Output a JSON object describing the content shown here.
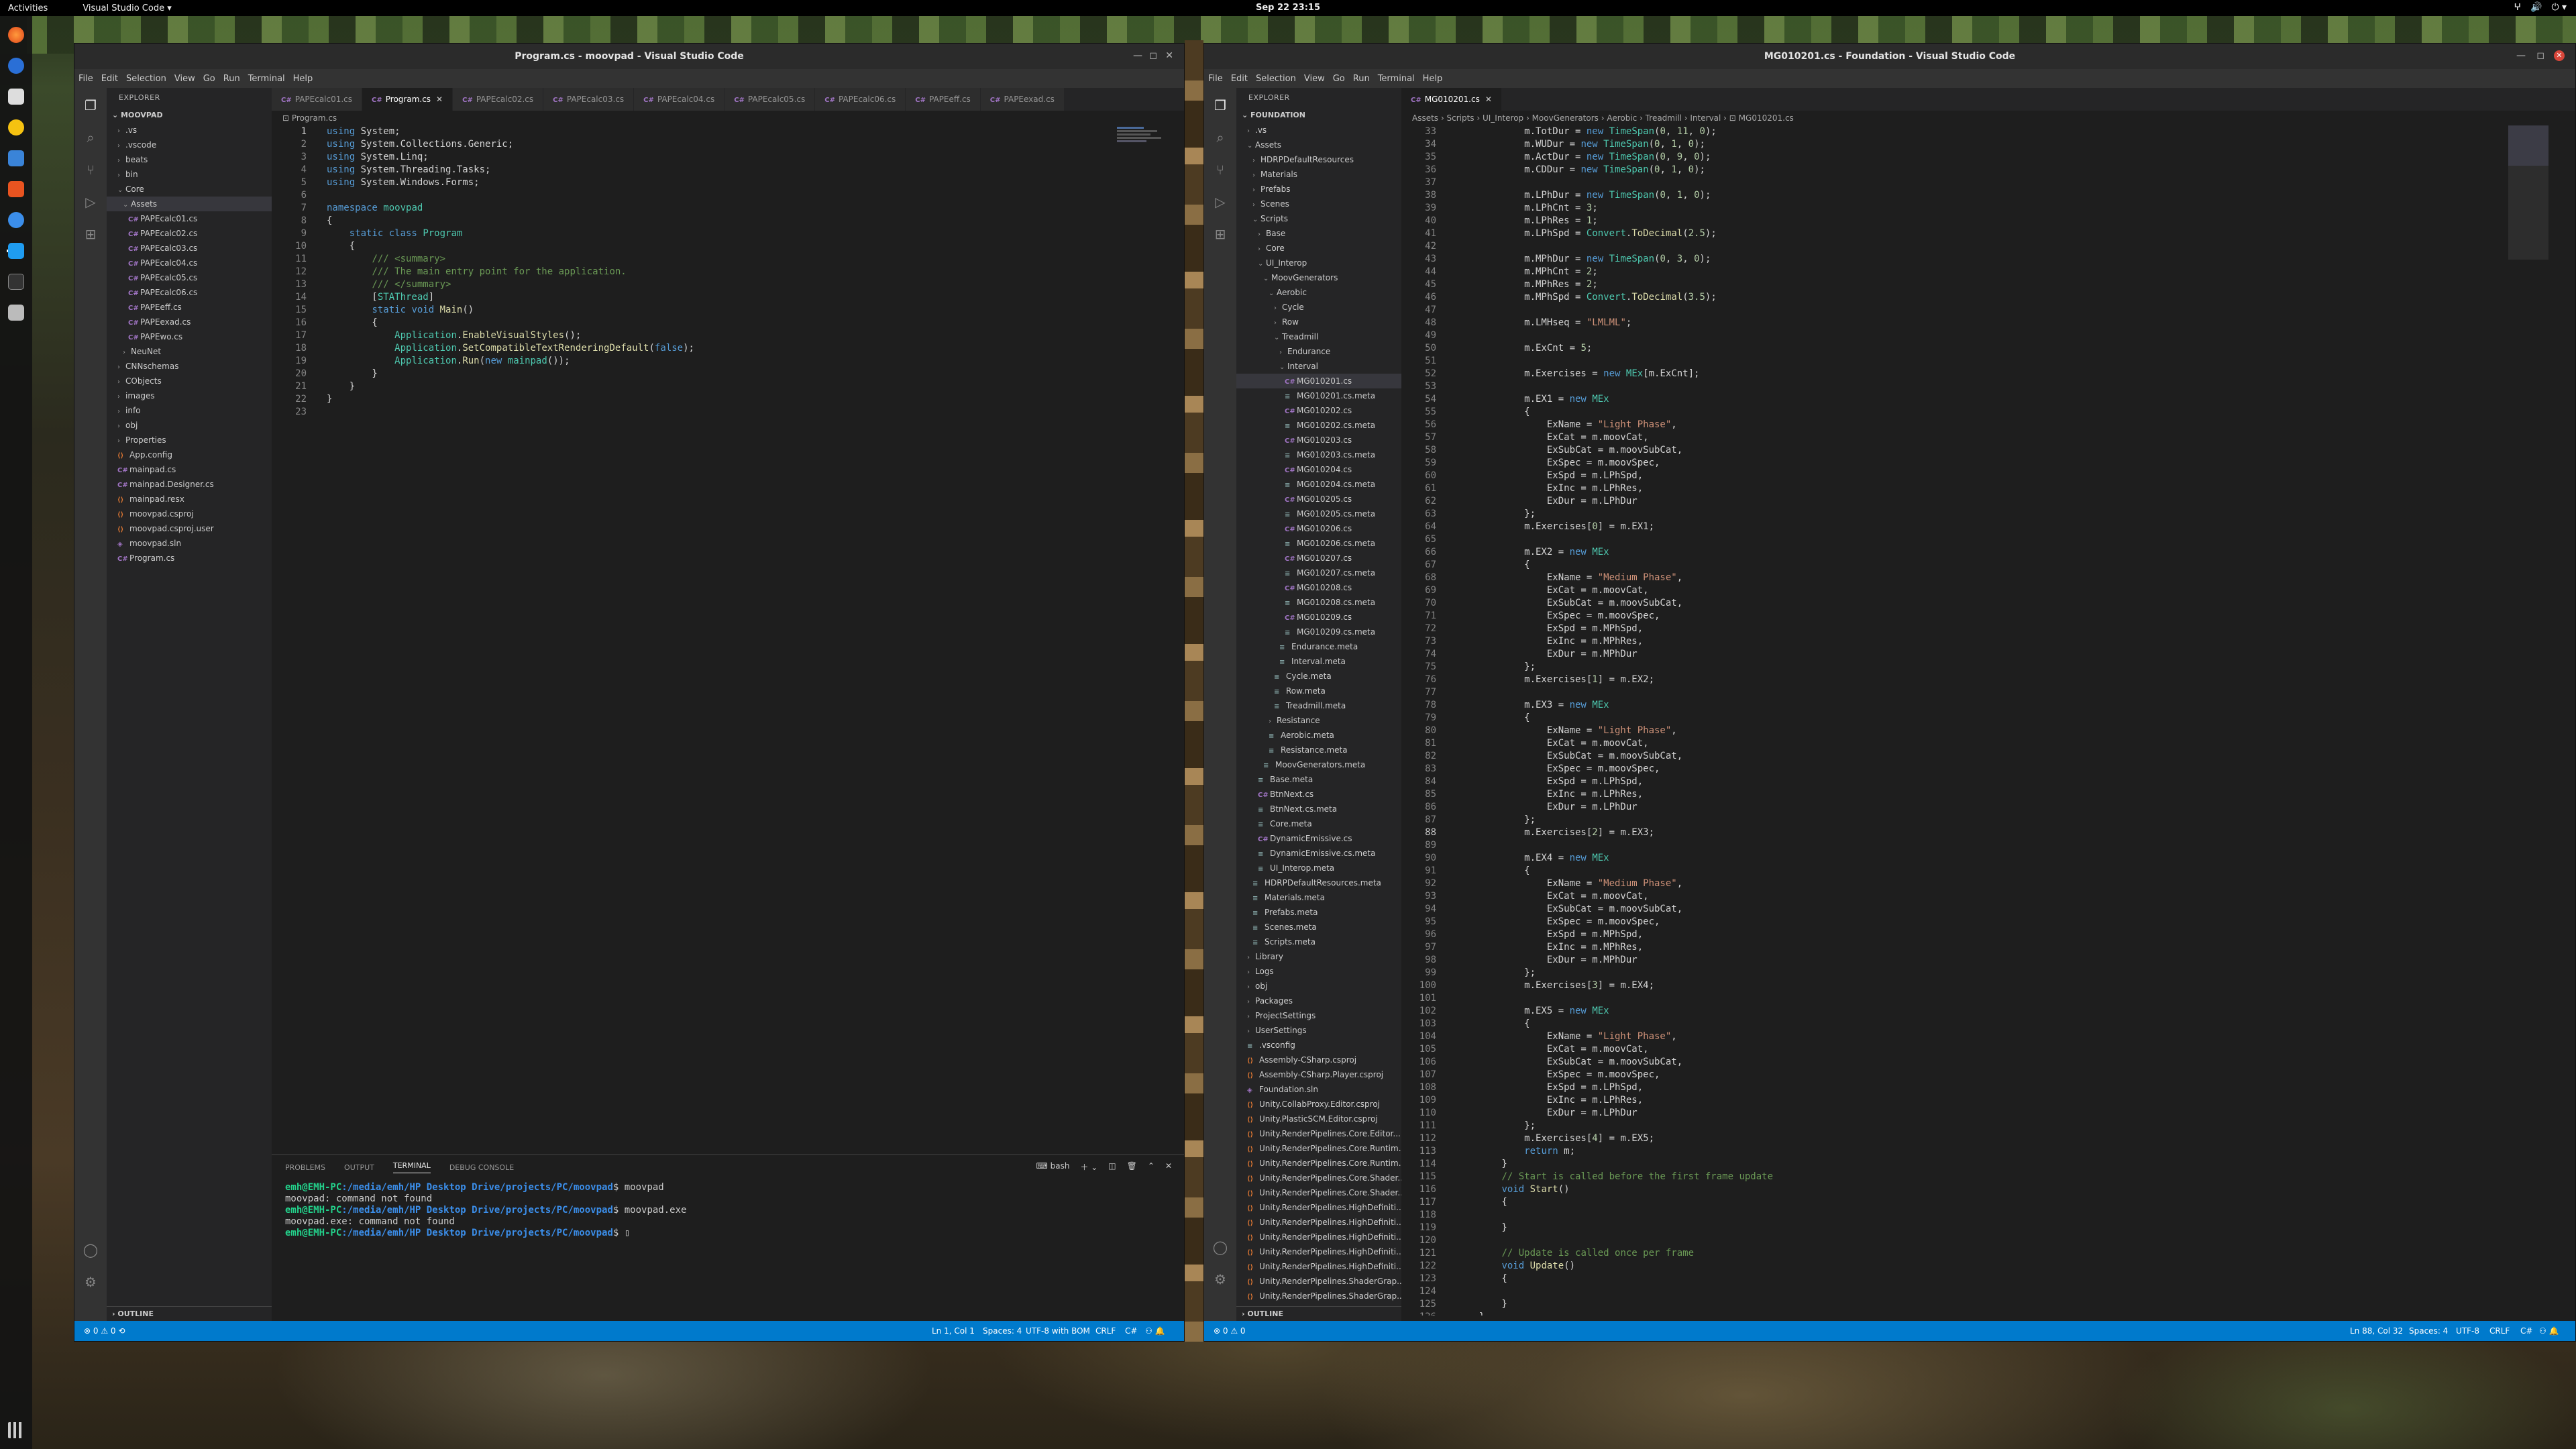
{
  "topbar": {
    "activities": "Activities",
    "app_menu": "Visual Studio Code ▾",
    "clock": "Sep 22  23:15",
    "tray": [
      "ⵖ",
      "🔊",
      "⏻ ▾"
    ]
  },
  "colors": {
    "vscode_blue": "#007acc",
    "editor_bg": "#1e1e1e",
    "sidebar_bg": "#252526"
  },
  "left_window": {
    "title": "Program.cs - moovpad - Visual Studio Code",
    "menu": [
      "File",
      "Edit",
      "Selection",
      "View",
      "Go",
      "Run",
      "Terminal",
      "Help"
    ],
    "explorer_title": "EXPLORER",
    "root": "MOOVPAD",
    "tree": [
      {
        "label": ".vs",
        "depth": 1,
        "kind": "folder"
      },
      {
        "label": ".vscode",
        "depth": 1,
        "kind": "folder"
      },
      {
        "label": "beats",
        "depth": 1,
        "kind": "folder"
      },
      {
        "label": "bin",
        "depth": 1,
        "kind": "folder"
      },
      {
        "label": "Core",
        "depth": 1,
        "kind": "folder-open"
      },
      {
        "label": "Assets",
        "depth": 2,
        "kind": "folder-open",
        "selected": true
      },
      {
        "label": "PAPEcalc01.cs",
        "depth": 3,
        "kind": "cs"
      },
      {
        "label": "PAPEcalc02.cs",
        "depth": 3,
        "kind": "cs"
      },
      {
        "label": "PAPEcalc03.cs",
        "depth": 3,
        "kind": "cs"
      },
      {
        "label": "PAPEcalc04.cs",
        "depth": 3,
        "kind": "cs"
      },
      {
        "label": "PAPEcalc05.cs",
        "depth": 3,
        "kind": "cs"
      },
      {
        "label": "PAPEcalc06.cs",
        "depth": 3,
        "kind": "cs"
      },
      {
        "label": "PAPEeff.cs",
        "depth": 3,
        "kind": "cs"
      },
      {
        "label": "PAPEexad.cs",
        "depth": 3,
        "kind": "cs"
      },
      {
        "label": "PAPEwo.cs",
        "depth": 3,
        "kind": "cs"
      },
      {
        "label": "NeuNet",
        "depth": 2,
        "kind": "folder"
      },
      {
        "label": "CNNschemas",
        "depth": 1,
        "kind": "folder"
      },
      {
        "label": "CObjects",
        "depth": 1,
        "kind": "folder"
      },
      {
        "label": "images",
        "depth": 1,
        "kind": "folder"
      },
      {
        "label": "info",
        "depth": 1,
        "kind": "folder"
      },
      {
        "label": "obj",
        "depth": 1,
        "kind": "folder"
      },
      {
        "label": "Properties",
        "depth": 1,
        "kind": "folder"
      },
      {
        "label": "App.config",
        "depth": 1,
        "kind": "xml"
      },
      {
        "label": "mainpad.cs",
        "depth": 1,
        "kind": "cs"
      },
      {
        "label": "mainpad.Designer.cs",
        "depth": 1,
        "kind": "cs"
      },
      {
        "label": "mainpad.resx",
        "depth": 1,
        "kind": "resx"
      },
      {
        "label": "moovpad.csproj",
        "depth": 1,
        "kind": "xml"
      },
      {
        "label": "moovpad.csproj.user",
        "depth": 1,
        "kind": "xml"
      },
      {
        "label": "moovpad.sln",
        "depth": 1,
        "kind": "sln"
      },
      {
        "label": "Program.cs",
        "depth": 1,
        "kind": "cs"
      }
    ],
    "outline": "OUTLINE",
    "tabs": [
      "PAPEcalc01.cs",
      "Program.cs",
      "PAPEcalc02.cs",
      "PAPEcalc03.cs",
      "PAPEcalc04.cs",
      "PAPEcalc05.cs",
      "PAPEcalc06.cs",
      "PAPEeff.cs",
      "PAPEexad.cs"
    ],
    "active_tab": 1,
    "breadcrumb": "Program.cs",
    "code": [
      "<span class=\"kw\">using</span> System;",
      "<span class=\"kw\">using</span> System.Collections.Generic;",
      "<span class=\"kw\">using</span> System.Linq;",
      "<span class=\"kw\">using</span> System.Threading.Tasks;",
      "<span class=\"kw\">using</span> System.Windows.Forms;",
      "",
      "<span class=\"kw\">namespace</span> <span class=\"ns\">moovpad</span>",
      "{",
      "    <span class=\"kw\">static class</span> <span class=\"ty\">Program</span>",
      "    {",
      "        <span class=\"cm\">/// &lt;summary&gt;</span>",
      "        <span class=\"cm\">/// The main entry point for the application.</span>",
      "        <span class=\"cm\">/// &lt;/summary&gt;</span>",
      "        [<span class=\"ty\">STAThread</span>]",
      "        <span class=\"kw\">static void</span> <span class=\"fn\">Main</span>()",
      "        {",
      "            <span class=\"ty\">Application</span>.<span class=\"fn\">EnableVisualStyles</span>();",
      "            <span class=\"ty\">Application</span>.<span class=\"fn\">SetCompatibleTextRenderingDefault</span>(<span class=\"kw\">false</span>);",
      "            <span class=\"ty\">Application</span>.<span class=\"fn\">Run</span>(<span class=\"kw\">new</span> <span class=\"ty\">mainpad</span>());",
      "        }",
      "    }",
      "}",
      ""
    ],
    "panel_tabs": [
      "PROBLEMS",
      "OUTPUT",
      "TERMINAL",
      "DEBUG CONSOLE"
    ],
    "panel_active": 2,
    "panel_shell": "bash",
    "terminal": [
      {
        "user": "emh@EMH-PC",
        "path": ":/media/emh/HP Desktop Drive/projects/PC/moovpad",
        "cmd": "$ moovpad"
      },
      {
        "text": "moovpad: command not found"
      },
      {
        "user": "emh@EMH-PC",
        "path": ":/media/emh/HP Desktop Drive/projects/PC/moovpad",
        "cmd": "$ moovpad.exe"
      },
      {
        "text": "moovpad.exe: command not found"
      },
      {
        "user": "emh@EMH-PC",
        "path": ":/media/emh/HP Desktop Drive/projects/PC/moovpad",
        "cmd": "$ ▯"
      }
    ],
    "status": {
      "left": "⊗ 0 ⚠ 0  ⟲",
      "pos": "Ln 1, Col 1",
      "spaces": "Spaces: 4",
      "enc": "UTF-8 with BOM",
      "eol": "CRLF",
      "lang": "C#",
      "icons": "⚇ 🔔"
    }
  },
  "right_window": {
    "title": "MG010201.cs - Foundation - Visual Studio Code",
    "menu": [
      "File",
      "Edit",
      "Selection",
      "View",
      "Go",
      "Run",
      "Terminal",
      "Help"
    ],
    "explorer_title": "EXPLORER",
    "root": "FOUNDATION",
    "tree": [
      {
        "label": ".vs",
        "depth": 1,
        "kind": "folder"
      },
      {
        "label": "Assets",
        "depth": 1,
        "kind": "folder-open"
      },
      {
        "label": "HDRPDefaultResources",
        "depth": 2,
        "kind": "folder"
      },
      {
        "label": "Materials",
        "depth": 2,
        "kind": "folder"
      },
      {
        "label": "Prefabs",
        "depth": 2,
        "kind": "folder"
      },
      {
        "label": "Scenes",
        "depth": 2,
        "kind": "folder"
      },
      {
        "label": "Scripts",
        "depth": 2,
        "kind": "folder-open"
      },
      {
        "label": "Base",
        "depth": 3,
        "kind": "folder"
      },
      {
        "label": "Core",
        "depth": 3,
        "kind": "folder"
      },
      {
        "label": "UI_Interop",
        "depth": 3,
        "kind": "folder-open"
      },
      {
        "label": "MoovGenerators",
        "depth": 4,
        "kind": "folder-open"
      },
      {
        "label": "Aerobic",
        "depth": 5,
        "kind": "folder-open"
      },
      {
        "label": "Cycle",
        "depth": 6,
        "kind": "folder"
      },
      {
        "label": "Row",
        "depth": 6,
        "kind": "folder"
      },
      {
        "label": "Treadmill",
        "depth": 6,
        "kind": "folder-open"
      },
      {
        "label": "Endurance",
        "depth": 7,
        "kind": "folder"
      },
      {
        "label": "Interval",
        "depth": 7,
        "kind": "folder-open"
      },
      {
        "label": "MG010201.cs",
        "depth": 8,
        "kind": "cs",
        "selected": true
      },
      {
        "label": "MG010201.cs.meta",
        "depth": 8,
        "kind": "meta"
      },
      {
        "label": "MG010202.cs",
        "depth": 8,
        "kind": "cs"
      },
      {
        "label": "MG010202.cs.meta",
        "depth": 8,
        "kind": "meta"
      },
      {
        "label": "MG010203.cs",
        "depth": 8,
        "kind": "cs"
      },
      {
        "label": "MG010203.cs.meta",
        "depth": 8,
        "kind": "meta"
      },
      {
        "label": "MG010204.cs",
        "depth": 8,
        "kind": "cs"
      },
      {
        "label": "MG010204.cs.meta",
        "depth": 8,
        "kind": "meta"
      },
      {
        "label": "MG010205.cs",
        "depth": 8,
        "kind": "cs"
      },
      {
        "label": "MG010205.cs.meta",
        "depth": 8,
        "kind": "meta"
      },
      {
        "label": "MG010206.cs",
        "depth": 8,
        "kind": "cs"
      },
      {
        "label": "MG010206.cs.meta",
        "depth": 8,
        "kind": "meta"
      },
      {
        "label": "MG010207.cs",
        "depth": 8,
        "kind": "cs"
      },
      {
        "label": "MG010207.cs.meta",
        "depth": 8,
        "kind": "meta"
      },
      {
        "label": "MG010208.cs",
        "depth": 8,
        "kind": "cs"
      },
      {
        "label": "MG010208.cs.meta",
        "depth": 8,
        "kind": "meta"
      },
      {
        "label": "MG010209.cs",
        "depth": 8,
        "kind": "cs"
      },
      {
        "label": "MG010209.cs.meta",
        "depth": 8,
        "kind": "meta"
      },
      {
        "label": "Endurance.meta",
        "depth": 7,
        "kind": "meta"
      },
      {
        "label": "Interval.meta",
        "depth": 7,
        "kind": "meta"
      },
      {
        "label": "Cycle.meta",
        "depth": 6,
        "kind": "meta"
      },
      {
        "label": "Row.meta",
        "depth": 6,
        "kind": "meta"
      },
      {
        "label": "Treadmill.meta",
        "depth": 6,
        "kind": "meta"
      },
      {
        "label": "Resistance",
        "depth": 5,
        "kind": "folder"
      },
      {
        "label": "Aerobic.meta",
        "depth": 5,
        "kind": "meta"
      },
      {
        "label": "Resistance.meta",
        "depth": 5,
        "kind": "meta"
      },
      {
        "label": "MoovGenerators.meta",
        "depth": 4,
        "kind": "meta"
      },
      {
        "label": "Base.meta",
        "depth": 3,
        "kind": "meta"
      },
      {
        "label": "BtnNext.cs",
        "depth": 3,
        "kind": "cs"
      },
      {
        "label": "BtnNext.cs.meta",
        "depth": 3,
        "kind": "meta"
      },
      {
        "label": "Core.meta",
        "depth": 3,
        "kind": "meta"
      },
      {
        "label": "DynamicEmissive.cs",
        "depth": 3,
        "kind": "cs"
      },
      {
        "label": "DynamicEmissive.cs.meta",
        "depth": 3,
        "kind": "meta"
      },
      {
        "label": "UI_Interop.meta",
        "depth": 3,
        "kind": "meta"
      },
      {
        "label": "HDRPDefaultResources.meta",
        "depth": 2,
        "kind": "meta"
      },
      {
        "label": "Materials.meta",
        "depth": 2,
        "kind": "meta"
      },
      {
        "label": "Prefabs.meta",
        "depth": 2,
        "kind": "meta"
      },
      {
        "label": "Scenes.meta",
        "depth": 2,
        "kind": "meta"
      },
      {
        "label": "Scripts.meta",
        "depth": 2,
        "kind": "meta"
      },
      {
        "label": "Library",
        "depth": 1,
        "kind": "folder"
      },
      {
        "label": "Logs",
        "depth": 1,
        "kind": "folder"
      },
      {
        "label": "obj",
        "depth": 1,
        "kind": "folder"
      },
      {
        "label": "Packages",
        "depth": 1,
        "kind": "folder"
      },
      {
        "label": "ProjectSettings",
        "depth": 1,
        "kind": "folder"
      },
      {
        "label": "UserSettings",
        "depth": 1,
        "kind": "folder"
      },
      {
        "label": ".vsconfig",
        "depth": 1,
        "kind": "meta"
      },
      {
        "label": "Assembly-CSharp.csproj",
        "depth": 1,
        "kind": "xml"
      },
      {
        "label": "Assembly-CSharp.Player.csproj",
        "depth": 1,
        "kind": "xml"
      },
      {
        "label": "Foundation.sln",
        "depth": 1,
        "kind": "sln"
      },
      {
        "label": "Unity.CollabProxy.Editor.csproj",
        "depth": 1,
        "kind": "xml"
      },
      {
        "label": "Unity.PlasticSCM.Editor.csproj",
        "depth": 1,
        "kind": "xml"
      },
      {
        "label": "Unity.RenderPipelines.Core.Editor...",
        "depth": 1,
        "kind": "xml"
      },
      {
        "label": "Unity.RenderPipelines.Core.Runtim...",
        "depth": 1,
        "kind": "xml"
      },
      {
        "label": "Unity.RenderPipelines.Core.Runtim...",
        "depth": 1,
        "kind": "xml"
      },
      {
        "label": "Unity.RenderPipelines.Core.Shader...",
        "depth": 1,
        "kind": "xml"
      },
      {
        "label": "Unity.RenderPipelines.Core.Shader...",
        "depth": 1,
        "kind": "xml"
      },
      {
        "label": "Unity.RenderPipelines.HighDefiniti...",
        "depth": 1,
        "kind": "xml"
      },
      {
        "label": "Unity.RenderPipelines.HighDefiniti...",
        "depth": 1,
        "kind": "xml"
      },
      {
        "label": "Unity.RenderPipelines.HighDefiniti...",
        "depth": 1,
        "kind": "xml"
      },
      {
        "label": "Unity.RenderPipelines.HighDefiniti...",
        "depth": 1,
        "kind": "xml"
      },
      {
        "label": "Unity.RenderPipelines.HighDefiniti...",
        "depth": 1,
        "kind": "xml"
      },
      {
        "label": "Unity.RenderPipelines.ShaderGrap...",
        "depth": 1,
        "kind": "xml"
      },
      {
        "label": "Unity.RenderPipelines.ShaderGrap...",
        "depth": 1,
        "kind": "xml"
      }
    ],
    "outline": "OUTLINE",
    "tabs": [
      "MG010201.cs"
    ],
    "active_tab": 0,
    "breadcrumb": "Assets › Scripts › UI_Interop › MoovGenerators › Aerobic › Treadmill › Interval › ⊡ MG010201.cs",
    "first_line": 33,
    "current_line": 88,
    "code": [
      "            m.TotDur = <span class=\"kw\">new</span> <span class=\"ty\">TimeSpan</span>(<span class=\"nu\">0</span>, <span class=\"nu\">11</span>, <span class=\"nu\">0</span>);",
      "            m.WUDur = <span class=\"kw\">new</span> <span class=\"ty\">TimeSpan</span>(<span class=\"nu\">0</span>, <span class=\"nu\">1</span>, <span class=\"nu\">0</span>);",
      "            m.ActDur = <span class=\"kw\">new</span> <span class=\"ty\">TimeSpan</span>(<span class=\"nu\">0</span>, <span class=\"nu\">9</span>, <span class=\"nu\">0</span>);",
      "            m.CDDur = <span class=\"kw\">new</span> <span class=\"ty\">TimeSpan</span>(<span class=\"nu\">0</span>, <span class=\"nu\">1</span>, <span class=\"nu\">0</span>);",
      "",
      "            m.LPhDur = <span class=\"kw\">new</span> <span class=\"ty\">TimeSpan</span>(<span class=\"nu\">0</span>, <span class=\"nu\">1</span>, <span class=\"nu\">0</span>);",
      "            m.LPhCnt = <span class=\"nu\">3</span>;",
      "            m.LPhRes = <span class=\"nu\">1</span>;",
      "            m.LPhSpd = <span class=\"ty\">Convert</span>.<span class=\"fn\">ToDecimal</span>(<span class=\"nu\">2.5</span>);",
      "",
      "            m.MPhDur = <span class=\"kw\">new</span> <span class=\"ty\">TimeSpan</span>(<span class=\"nu\">0</span>, <span class=\"nu\">3</span>, <span class=\"nu\">0</span>);",
      "            m.MPhCnt = <span class=\"nu\">2</span>;",
      "            m.MPhRes = <span class=\"nu\">2</span>;",
      "            m.MPhSpd = <span class=\"ty\">Convert</span>.<span class=\"fn\">ToDecimal</span>(<span class=\"nu\">3.5</span>);",
      "",
      "            m.LMHseq = <span class=\"st\">\"LMLML\"</span>;",
      "",
      "            m.ExCnt = <span class=\"nu\">5</span>;",
      "",
      "            m.Exercises = <span class=\"kw\">new</span> <span class=\"ty\">MEx</span>[m.ExCnt];",
      "",
      "            m.EX1 = <span class=\"kw\">new</span> <span class=\"ty\">MEx</span>",
      "            {",
      "                ExName = <span class=\"st\">\"Light Phase\"</span>,",
      "                ExCat = m.moovCat,",
      "                ExSubCat = m.moovSubCat,",
      "                ExSpec = m.moovSpec,",
      "                ExSpd = m.LPhSpd,",
      "                ExInc = m.LPhRes,",
      "                ExDur = m.LPhDur",
      "            };",
      "            m.Exercises[<span class=\"nu\">0</span>] = m.EX1;",
      "",
      "            m.EX2 = <span class=\"kw\">new</span> <span class=\"ty\">MEx</span>",
      "            {",
      "                ExName = <span class=\"st\">\"Medium Phase\"</span>,",
      "                ExCat = m.moovCat,",
      "                ExSubCat = m.moovSubCat,",
      "                ExSpec = m.moovSpec,",
      "                ExSpd = m.MPhSpd,",
      "                ExInc = m.MPhRes,",
      "                ExDur = m.MPhDur",
      "            };",
      "            m.Exercises[<span class=\"nu\">1</span>] = m.EX2;",
      "",
      "            m.EX3 = <span class=\"kw\">new</span> <span class=\"ty\">MEx</span>",
      "            {",
      "                ExName = <span class=\"st\">\"Light Phase\"</span>,",
      "                ExCat = m.moovCat,",
      "                ExSubCat = m.moovSubCat,",
      "                ExSpec = m.moovSpec,",
      "                ExSpd = m.LPhSpd,",
      "                ExInc = m.LPhRes,",
      "                ExDur = m.LPhDur",
      "            };",
      "            m.Exercises[<span class=\"nu\">2</span>] = m.EX3;",
      "",
      "            m.EX4 = <span class=\"kw\">new</span> <span class=\"ty\">MEx</span>",
      "            {",
      "                ExName = <span class=\"st\">\"Medium Phase\"</span>,",
      "                ExCat = m.moovCat,",
      "                ExSubCat = m.moovSubCat,",
      "                ExSpec = m.moovSpec,",
      "                ExSpd = m.MPhSpd,",
      "                ExInc = m.MPhRes,",
      "                ExDur = m.MPhDur",
      "            };",
      "            m.Exercises[<span class=\"nu\">3</span>] = m.EX4;",
      "",
      "            m.EX5 = <span class=\"kw\">new</span> <span class=\"ty\">MEx</span>",
      "            {",
      "                ExName = <span class=\"st\">\"Light Phase\"</span>,",
      "                ExCat = m.moovCat,",
      "                ExSubCat = m.moovSubCat,",
      "                ExSpec = m.moovSpec,",
      "                ExSpd = m.LPhSpd,",
      "                ExInc = m.LPhRes,",
      "                ExDur = m.LPhDur",
      "            };",
      "            m.Exercises[<span class=\"nu\">4</span>] = m.EX5;",
      "            <span class=\"kw\">return</span> m;",
      "        }",
      "        <span class=\"cm\">// Start is called before the first frame update</span>",
      "        <span class=\"kw\">void</span> <span class=\"fn\">Start</span>()",
      "        {",
      "",
      "        }",
      "",
      "        <span class=\"cm\">// Update is called once per frame</span>",
      "        <span class=\"kw\">void</span> <span class=\"fn\">Update</span>()",
      "        {",
      "",
      "        }",
      "    }"
    ],
    "status": {
      "left": "⊗ 0 ⚠ 0",
      "pos": "Ln 88, Col 32",
      "spaces": "Spaces: 4",
      "enc": "UTF-8",
      "eol": "CRLF",
      "lang": "C#",
      "icons": "⚇ 🔔"
    }
  }
}
